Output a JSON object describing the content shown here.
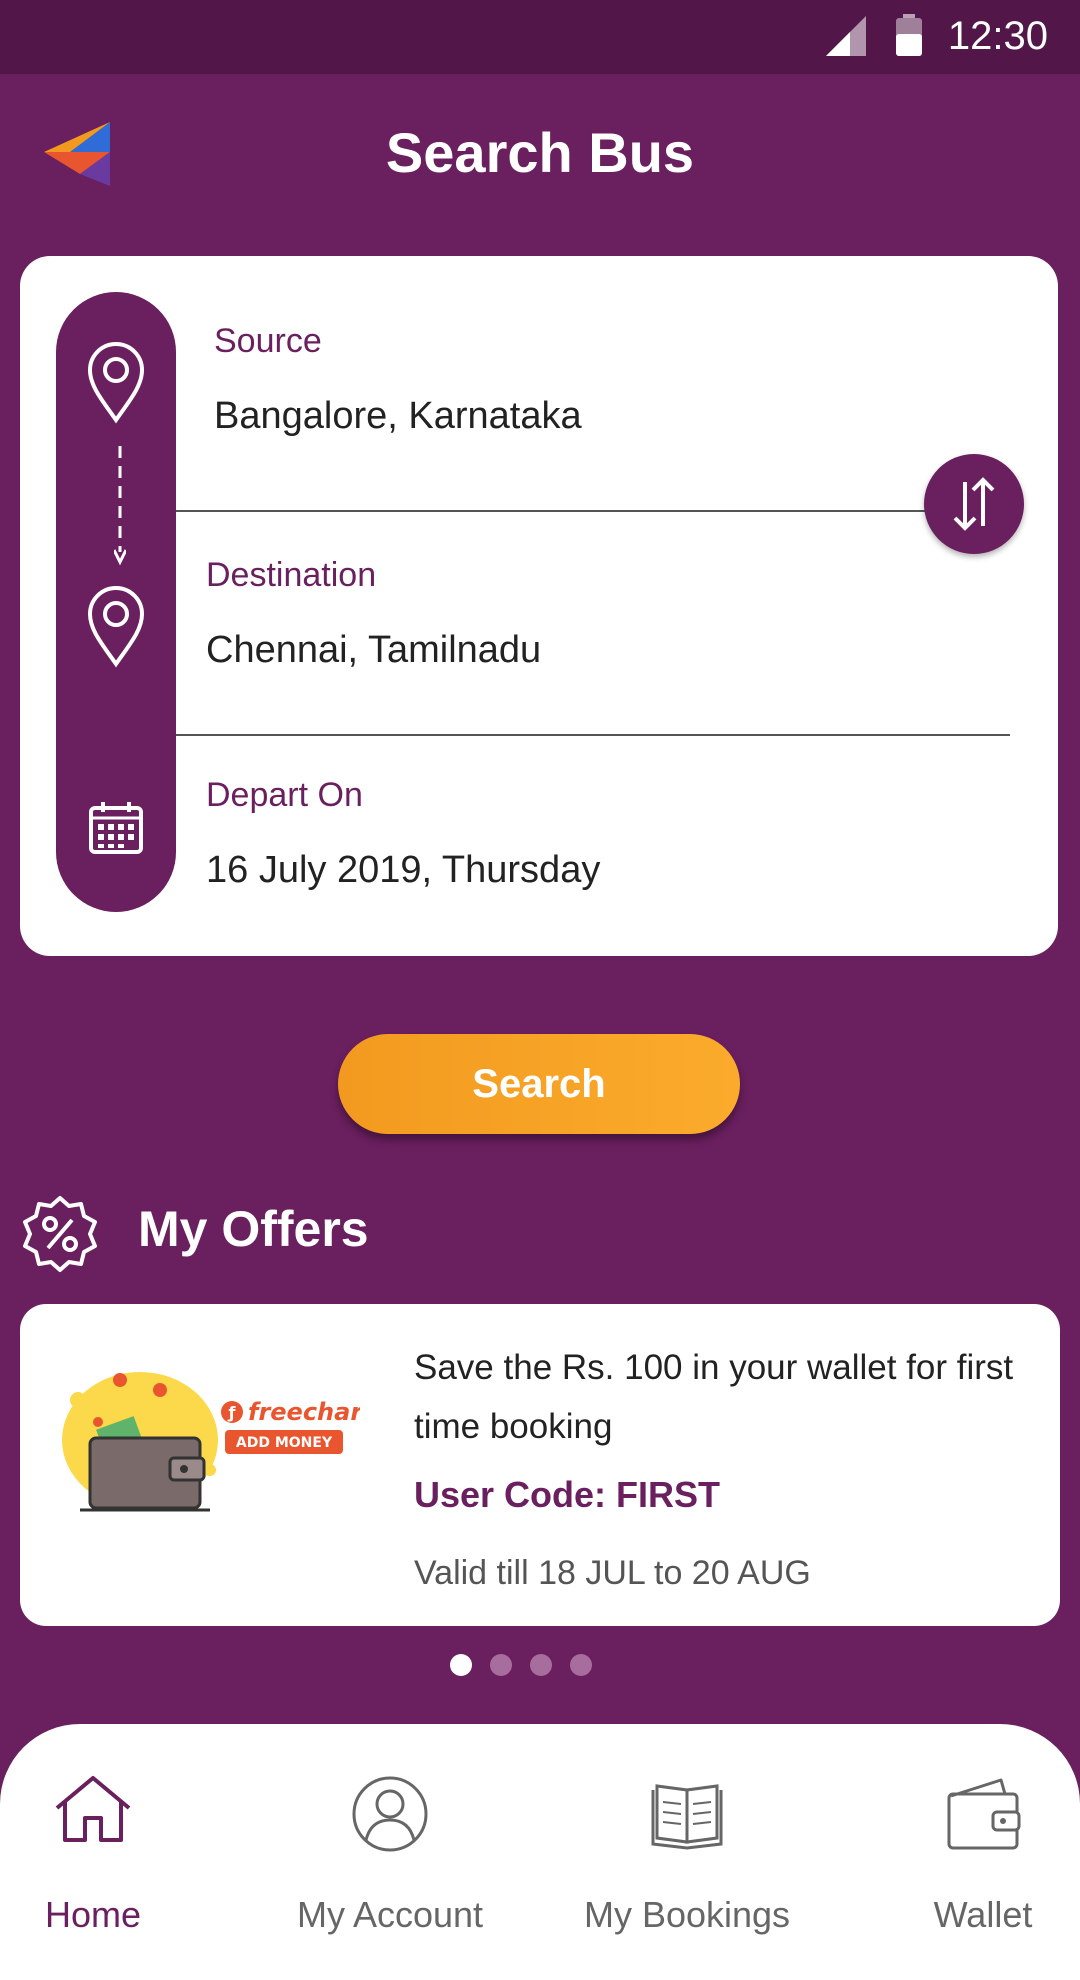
{
  "status_bar": {
    "time": "12:30"
  },
  "header": {
    "title": "Search Bus"
  },
  "search_form": {
    "source_label": "Source",
    "source_value": "Bangalore, Karnataka",
    "destination_label": "Destination",
    "destination_value": "Chennai, Tamilnadu",
    "depart_label": "Depart On",
    "depart_value": "16 July 2019, Thursday"
  },
  "search_button": "Search",
  "offers": {
    "heading": "My Offers",
    "card": {
      "brand": "freecharge",
      "brand_tag": "ADD MONEY",
      "description": "Save the Rs. 100 in your wallet for first time booking",
      "code": "User Code: FIRST",
      "validity": "Valid till 18 JUL to 20 AUG"
    },
    "carousel": {
      "count": 4,
      "active_index": 0
    }
  },
  "bottom_nav": [
    {
      "label": "Home",
      "icon": "home-icon",
      "active": true
    },
    {
      "label": "My Account",
      "icon": "account-icon",
      "active": false
    },
    {
      "label": "My Bookings",
      "icon": "bookings-icon",
      "active": false
    },
    {
      "label": "Wallet",
      "icon": "wallet-icon",
      "active": false
    }
  ],
  "colors": {
    "primary": "#6a1f5f",
    "status_bar": "#521649",
    "accent": "#f7a124"
  }
}
